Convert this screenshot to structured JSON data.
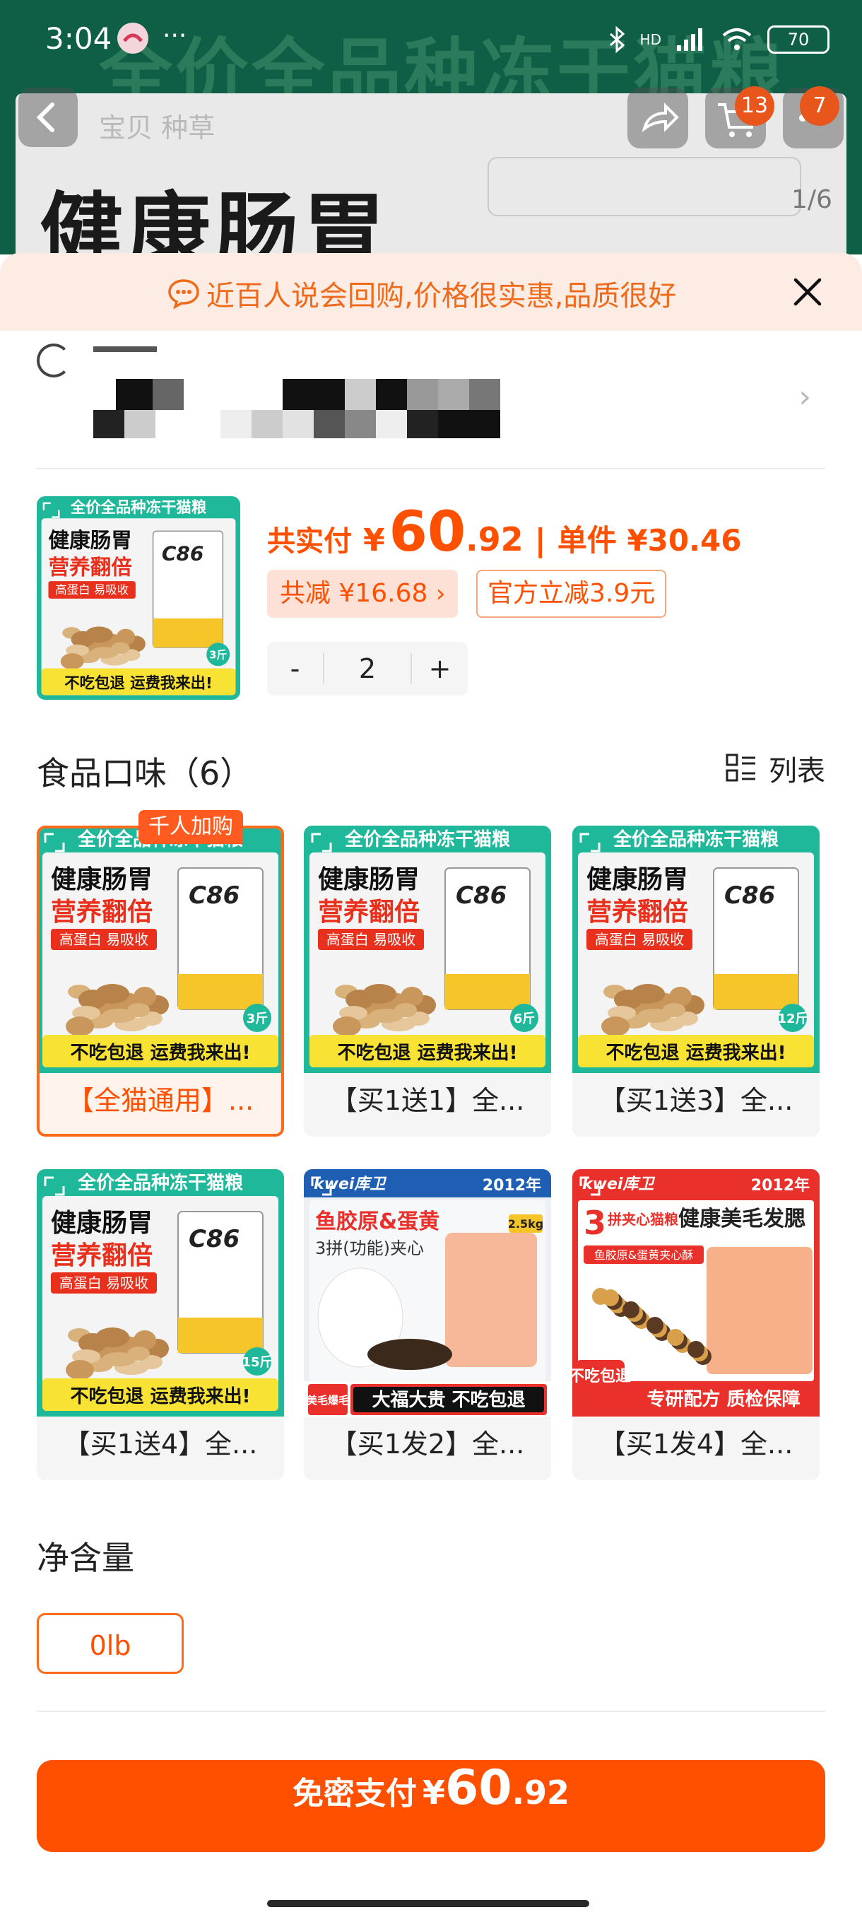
{
  "status_bar": {
    "time": "3:04",
    "dots": "···",
    "battery": "70",
    "network": "HD"
  },
  "background": {
    "banner": "全价全品种冻干猫粮",
    "tabs": "宝贝  种草",
    "headline": "健康肠胃",
    "counter": "1/6",
    "cart_badge": "13",
    "more_badge": "7"
  },
  "notice": {
    "text": "近百人说会回购,价格很实惠,品质很好"
  },
  "product": {
    "price_label": "共实付",
    "currency": "¥",
    "price_int": "60",
    "price_dec": ".92",
    "separator": "|",
    "unit_price": "单件 ¥30.46",
    "reduce_tag": "共减 ¥16.68",
    "official_tag": "官方立减3.9元",
    "quantity": "2",
    "minus": "-",
    "plus": "+"
  },
  "thumb_art": {
    "top": "全价全品种冻干猫粮",
    "line1": "健康肠胃",
    "line2": "营养翻倍",
    "chip": "高蛋白  易吸收",
    "bottom": "不吃包退 运费我来出!",
    "brand": "C86"
  },
  "flavor": {
    "title": "食品口味（6）",
    "view_label": "列表",
    "hot_badge": "千人加购",
    "options": [
      {
        "label": "【全猫通用】...",
        "weight": "3斤"
      },
      {
        "label": "【买1送1】全...",
        "weight": "6斤"
      },
      {
        "label": "【买1送3】全...",
        "weight": "12斤"
      },
      {
        "label": "【买1送4】全...",
        "weight": "15斤"
      },
      {
        "label": "【买1发2】全...",
        "year": "2012年",
        "brand": "kwei库卫",
        "l1": "鱼胶原&蛋黄",
        "l2": "3拼(功能)夹心",
        "weight": "2.5kg",
        "tag1": "美毛爆毛",
        "bottom": "大福大贵 不吃包退"
      },
      {
        "label": "【买1发4】全...",
        "year": "2012年",
        "brand": "kwei库卫",
        "l1": "健康美毛发腮",
        "big": "3",
        "l2": "拼夹心猫粮",
        "chip": "鱼胶原&蛋黄夹心酥",
        "tag1": "不吃包退",
        "bottom": "专研配方 质检保障"
      }
    ]
  },
  "net_content": {
    "title": "净含量",
    "option": "0lb"
  },
  "pay": {
    "label": "免密支付",
    "currency": "¥",
    "int": "60",
    "dec": ".92"
  },
  "colors": {
    "accent": "#ff5000",
    "teal": "#1fb89a",
    "bg_green": "#0f5e46"
  }
}
